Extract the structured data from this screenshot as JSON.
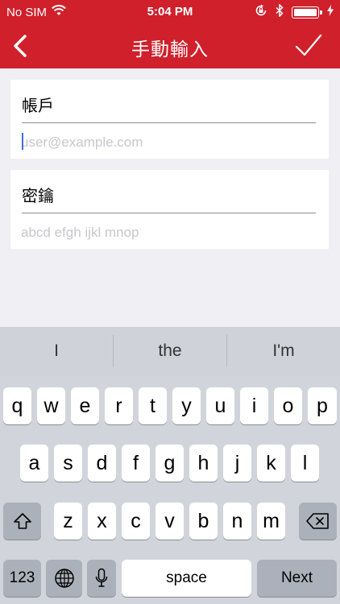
{
  "status_bar": {
    "carrier": "No SIM",
    "time": "5:04 PM"
  },
  "nav": {
    "title": "手動輸入"
  },
  "form": {
    "account_label": "帳戶",
    "account_placeholder": "user@example.com",
    "key_label": "密鑰",
    "key_placeholder": "abcd efgh ijkl mnop"
  },
  "keyboard": {
    "suggestions": [
      "I",
      "the",
      "I'm"
    ],
    "row1": [
      "q",
      "w",
      "e",
      "r",
      "t",
      "y",
      "u",
      "i",
      "o",
      "p"
    ],
    "row2": [
      "a",
      "s",
      "d",
      "f",
      "g",
      "h",
      "j",
      "k",
      "l"
    ],
    "row3": [
      "z",
      "x",
      "c",
      "v",
      "b",
      "n",
      "m"
    ],
    "numbers_label": "123",
    "space_label": "space",
    "next_label": "Next"
  },
  "colors": {
    "header_red": "#d0202b",
    "background": "#efeff4",
    "caret_blue": "#3f6fd8"
  }
}
